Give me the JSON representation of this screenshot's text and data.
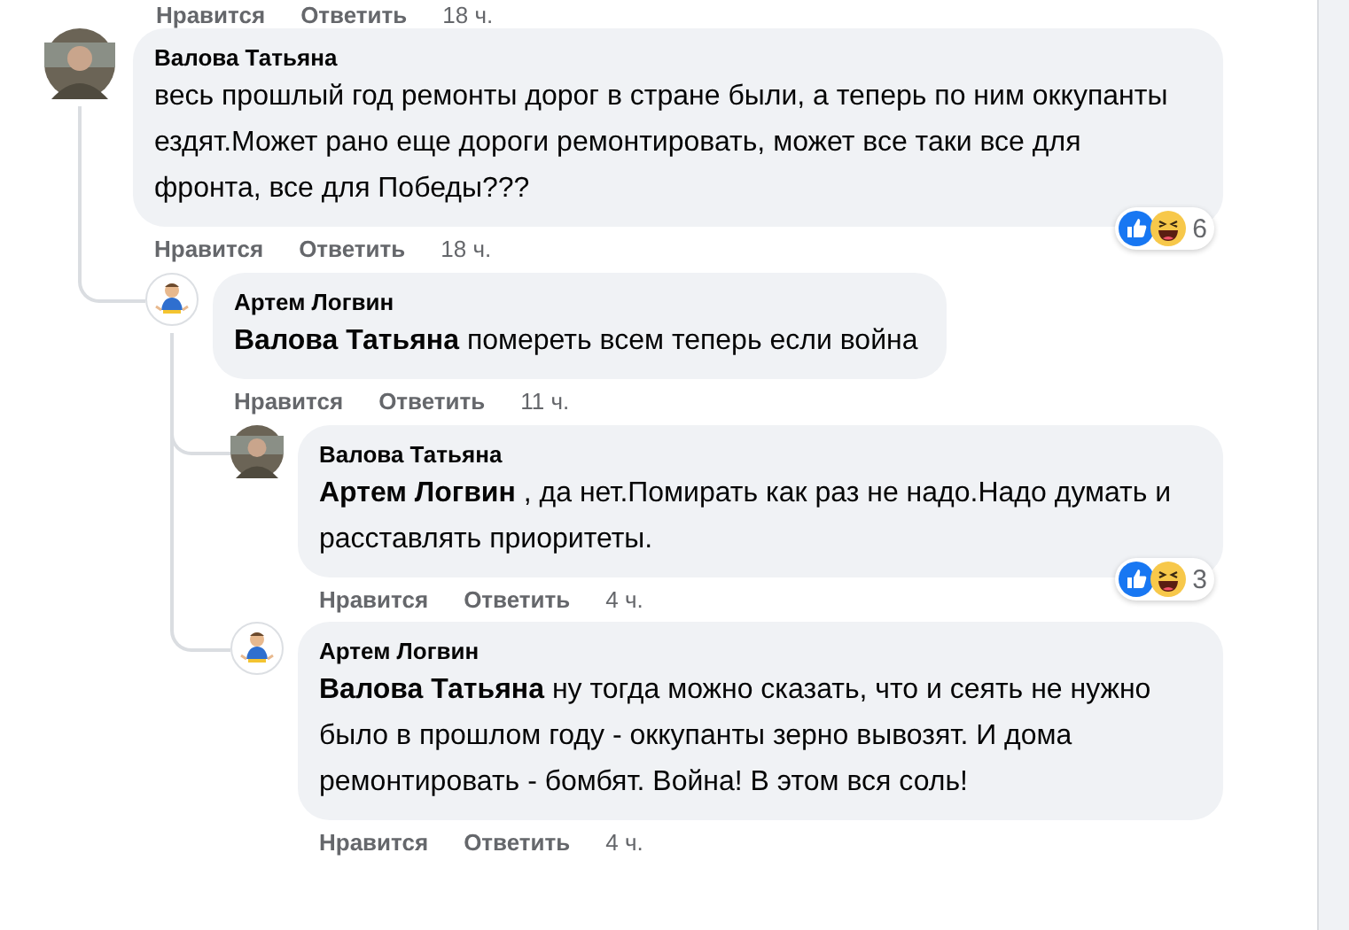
{
  "previous_actions": {
    "like": "Нравится",
    "reply": "Ответить",
    "time": "18 ч."
  },
  "comments": [
    {
      "author": "Валова Татьяна",
      "avatar": {
        "kind": "photo"
      },
      "text": "весь прошлый год ремонты дорог в стране были, а теперь по ним оккупанты ездят.Может рано еще дороги ремонтировать, может все таки все для фронта, все для Победы???",
      "like": "Нравится",
      "reply": "Ответить",
      "time": "18 ч.",
      "reactions": {
        "types": [
          {
            "kind": "like"
          },
          {
            "kind": "haha"
          }
        ],
        "count": "6"
      },
      "children": [
        {
          "author": "Артем Логвин",
          "avatar": {
            "kind": "cartoon"
          },
          "text": "**Валова Татьяна** помереть всем теперь если война",
          "like": "Нравится",
          "reply": "Ответить",
          "time": "11 ч.",
          "children": [
            {
              "author": "Валова Татьяна",
              "avatar": {
                "kind": "photo"
              },
              "text": "**Артем Логвин** , да нет.Помирать как раз не надо.Надо думать и расставлять приоритеты.",
              "like": "Нравится",
              "reply": "Ответить",
              "time": "4 ч.",
              "reactions": {
                "types": [
                  {
                    "kind": "like"
                  },
                  {
                    "kind": "haha"
                  }
                ],
                "count": "3"
              }
            },
            {
              "author": "Артем Логвин",
              "avatar": {
                "kind": "cartoon"
              },
              "text": "**Валова Татьяна** ну тогда можно сказать, что и сеять не нужно было в прошлом году - оккупанты зерно вывозят. И дома ремонтировать - бомбят. Война! В этом вся соль!",
              "like": "Нравится",
              "reply": "Ответить",
              "time": "4 ч."
            }
          ]
        }
      ]
    }
  ]
}
